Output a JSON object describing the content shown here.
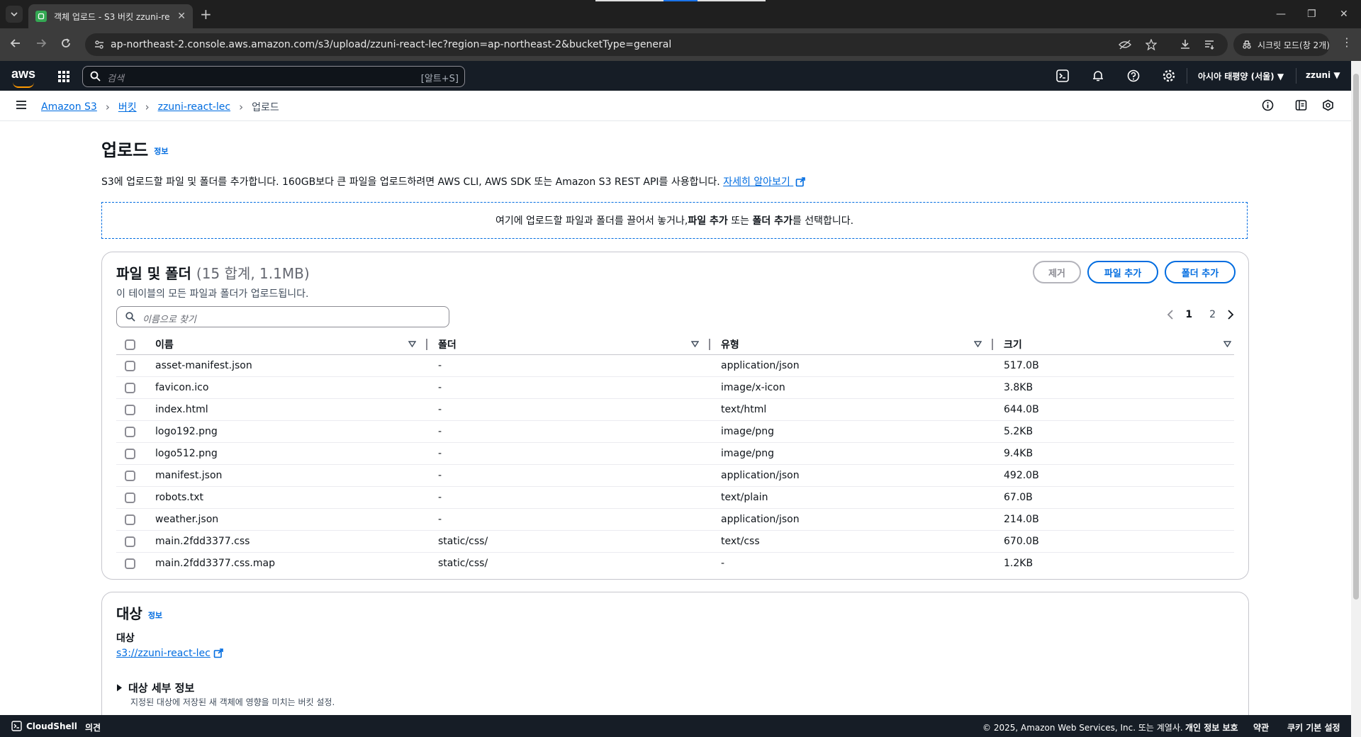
{
  "browser": {
    "tab_title": "객체 업로드 - S3 버킷 zzuni-re",
    "url": "ap-northeast-2.console.aws.amazon.com/s3/upload/zzuni-react-lec?region=ap-northeast-2&bucketType=general",
    "incognito_label": "시크릿 모드(창 2개)"
  },
  "aws_nav": {
    "logo": "aws",
    "search_placeholder": "검색",
    "search_shortcut": "[알트+S]",
    "region": "아시아 태평양 (서울) ▼",
    "user": "zzuni ▼"
  },
  "breadcrumb": [
    "Amazon S3",
    "버킷",
    "zzuni-react-lec",
    "업로드"
  ],
  "page": {
    "title": "업로드",
    "info": "정보",
    "description": "S3에 업로드할 파일 및 폴더를 추가합니다. 160GB보다 큰 파일을 업로드하려면 AWS CLI, AWS SDK 또는 Amazon S3 REST API를 사용합니다.",
    "learn_more": "자세히 알아보기",
    "dropzone_pre": "여기에 업로드할 파일과 폴더를 끌어서 놓거나, ",
    "dropzone_b1": "파일 추가",
    "dropzone_mid": " 또는 ",
    "dropzone_b2": "폴더 추가",
    "dropzone_post": "를 선택합니다."
  },
  "files_panel": {
    "title": "파일 및 폴더",
    "count": "(15 합계, 1.1MB)",
    "subtitle": "이 테이블의 모든 파일과 폴더가 업로드됩니다.",
    "remove_label": "제거",
    "add_files_label": "파일 추가",
    "add_folder_label": "폴더 추가",
    "filter_placeholder": "이름으로 찾기",
    "pages": [
      "1",
      "2"
    ],
    "columns": [
      "이름",
      "폴더",
      "유형",
      "크기"
    ],
    "rows": [
      [
        "asset-manifest.json",
        "-",
        "application/json",
        "517.0B"
      ],
      [
        "favicon.ico",
        "-",
        "image/x-icon",
        "3.8KB"
      ],
      [
        "index.html",
        "-",
        "text/html",
        "644.0B"
      ],
      [
        "logo192.png",
        "-",
        "image/png",
        "5.2KB"
      ],
      [
        "logo512.png",
        "-",
        "image/png",
        "9.4KB"
      ],
      [
        "manifest.json",
        "-",
        "application/json",
        "492.0B"
      ],
      [
        "robots.txt",
        "-",
        "text/plain",
        "67.0B"
      ],
      [
        "weather.json",
        "-",
        "application/json",
        "214.0B"
      ],
      [
        "main.2fdd3377.css",
        "static/css/",
        "text/css",
        "670.0B"
      ],
      [
        "main.2fdd3377.css.map",
        "static/css/",
        "-",
        "1.2KB"
      ]
    ]
  },
  "destination": {
    "title": "대상",
    "info": "정보",
    "label": "대상",
    "link": "s3://zzuni-react-lec",
    "details_title": "대상 세부 정보",
    "details_desc": "지정된 대상에 저장된 새 객체에 영향을 미치는 버킷 설정."
  },
  "footer": {
    "cloudshell": "CloudShell",
    "feedback": "의견",
    "copyright": "© 2025, Amazon Web Services, Inc. 또는 계열사.",
    "privacy": "개인 정보 보호",
    "terms": "약관",
    "cookies": "쿠키 기본 설정"
  },
  "colors": {
    "accent": "#006ce0",
    "nav_bg": "#161d26"
  }
}
